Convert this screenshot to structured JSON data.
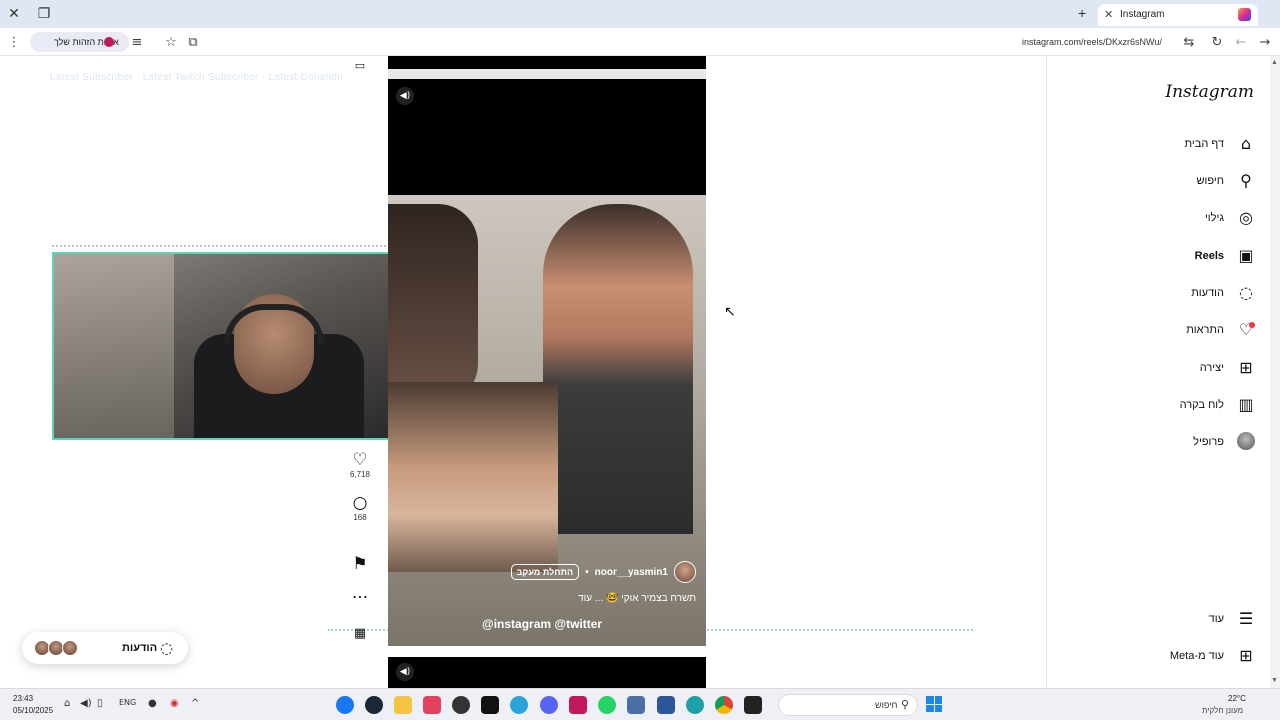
{
  "browser": {
    "tab_title": "Instagram",
    "url": "instagram.com/reels/DKxzr6sNWu/",
    "identity_chip": "איכות הזהות שלך"
  },
  "stream_overlay": {
    "top_text": "Latest Subscriber · Latest Twitch Subscriber · Latest Donation"
  },
  "reel": {
    "likes": "6,718",
    "comments": "168",
    "author": "noor__yasmin1",
    "follow_label": "התחלת מעקב",
    "caption": "תשרח בצמיר אוקי 🤓 ... עוד",
    "stream_bar": "@instagram   @twitter"
  },
  "sidebar": {
    "logo": "Instagram",
    "items": [
      {
        "label": "דף הבית",
        "icon": "⌂"
      },
      {
        "label": "חיפוש",
        "icon": "⚲"
      },
      {
        "label": "גילוי",
        "icon": "◎"
      },
      {
        "label": "Reels",
        "icon": "▣"
      },
      {
        "label": "הודעות",
        "icon": "◌"
      },
      {
        "label": "התראות",
        "icon": "♡"
      },
      {
        "label": "יצירה",
        "icon": "⊞"
      },
      {
        "label": "לוח בקרה",
        "icon": "▥"
      },
      {
        "label": "פרופיל",
        "icon": ""
      }
    ],
    "more": "עוד",
    "meta": "עוד מ-Meta"
  },
  "messages_pill": {
    "label": "הודעות"
  },
  "taskbar": {
    "time": "23:43",
    "date": "05/10/2025",
    "lang": "ENG",
    "search_placeholder": "חיפוש",
    "weather_temp": "22°C",
    "weather_desc": "מעונן חלקית"
  }
}
